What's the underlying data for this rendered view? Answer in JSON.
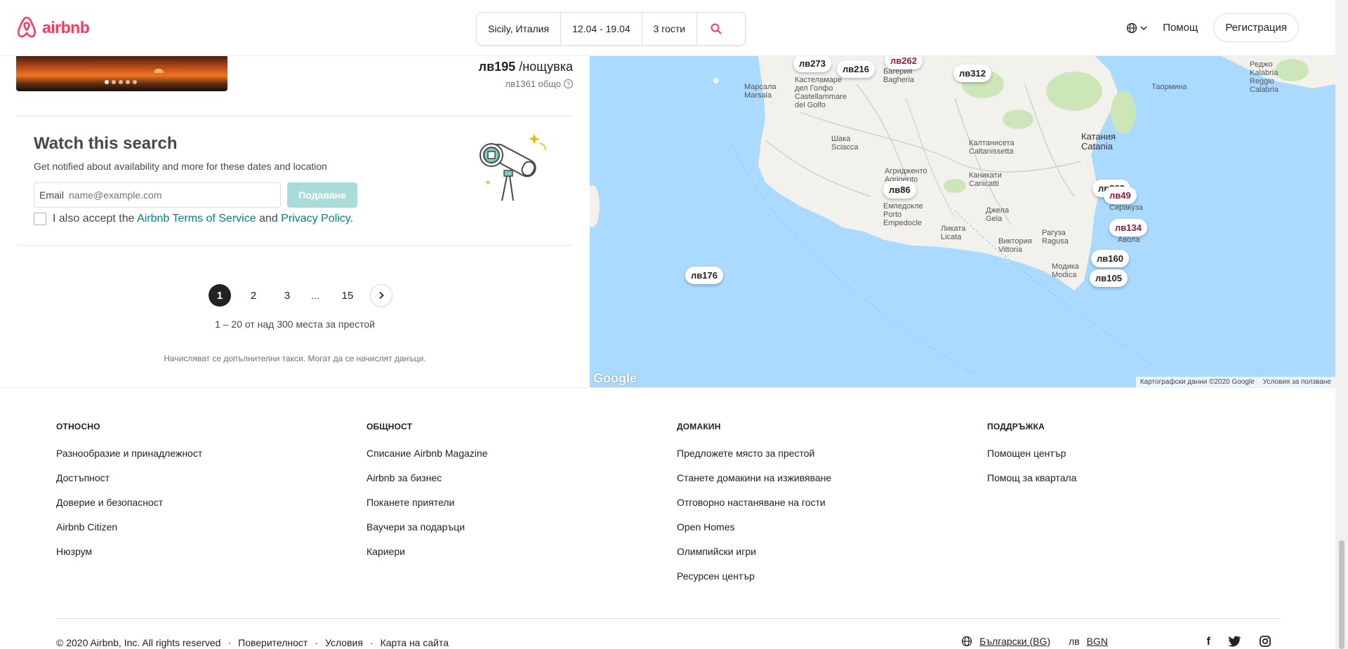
{
  "header": {
    "logo_text": "airbnb",
    "search": {
      "location": "Sicily, Италия",
      "dates": "12.04 - 19.04",
      "guests": "3 гости"
    },
    "help": "Помощ",
    "signup": "Регистрация"
  },
  "listing": {
    "price_main": "лв195",
    "price_unit": " /нощувка",
    "price_total": "лв1361 общо"
  },
  "watch": {
    "title": "Watch this search",
    "subtitle": "Get notified about availability and more for these dates and location",
    "email_label": "Email",
    "email_placeholder": "name@example.com",
    "submit": "Подаване",
    "terms_pre": "I also accept the ",
    "terms_link": "Airbnb Terms of Service",
    "terms_and": " and ",
    "privacy_link": "Privacy Policy",
    "terms_end": "."
  },
  "pagination": {
    "pages": [
      "1",
      "2",
      "3",
      "…",
      "15"
    ],
    "range_text": "1 – 20 от над 300 места за престой",
    "fees_text": "Начисляват се допълнителни такси. Могат да се начислят данъци."
  },
  "map": {
    "pins": [
      "лв273",
      "лв216",
      "лв262",
      "лв312",
      "лв86",
      "лв383",
      "лв49",
      "лв134",
      "лв160",
      "лв105",
      "лв176"
    ],
    "towns": [
      "Марсала\nMarsala",
      "Кастеламаре\nдел Голфо\nCastellammare\ndel Golfo",
      "Багерия\nBagheria",
      "Шака\nSciacca",
      "Агридженто\nAgrigento",
      "Калтанисета\nCaltanissetta",
      "Каникати\nCanicatti",
      "Катания\nCatania",
      "Сиракуза",
      "Авола",
      "Рагуза\nRagusa",
      "Джела\nGela",
      "Ликата\nLicata",
      "Виктория\nVittoria",
      "Модика\nModica",
      "Емпедокле\nPorto\nEmpedocle",
      "Таормина",
      "Реджо\nKalabria\nReggio\nCalabria"
    ],
    "google": "Google",
    "credits": "Картографски данни ©2020 Google",
    "terms": "Условия за ползване"
  },
  "footer": {
    "columns": [
      {
        "title": "ОТНОСНО",
        "links": [
          "Разнообразие и принадлежност",
          "Достъпност",
          "Доверие и безопасност",
          "Airbnb Citizen",
          "Нюзрум"
        ]
      },
      {
        "title": "ОБЩНОСТ",
        "links": [
          "Списание Airbnb Magazine",
          "Airbnb за бизнес",
          "Поканете приятели",
          "Ваучери за подаръци",
          "Кариери"
        ]
      },
      {
        "title": "ДОМАКИН",
        "links": [
          "Предложете място за престой",
          "Станете домакини на изживяване",
          "Отговорно настаняване на гости",
          "Open Homes",
          "Олимпийски игри",
          "Ресурсен център"
        ]
      },
      {
        "title": "ПОДДРЪЖКА",
        "links": [
          "Помощен център",
          "Помощ за квартала"
        ]
      }
    ],
    "copyright": "© 2020 Airbnb, Inc. All rights reserved",
    "privacy": "Поверителност",
    "terms": "Условия",
    "sitemap": "Карта на сайта",
    "sep": "·",
    "language": "Български (BG)",
    "currency_symbol": "лв",
    "currency": "BGN",
    "social": [
      "f",
      "t",
      "ig"
    ]
  },
  "colors": {
    "brand": "#ff385c",
    "teal": "#008489",
    "map_water": "#aadaff"
  }
}
